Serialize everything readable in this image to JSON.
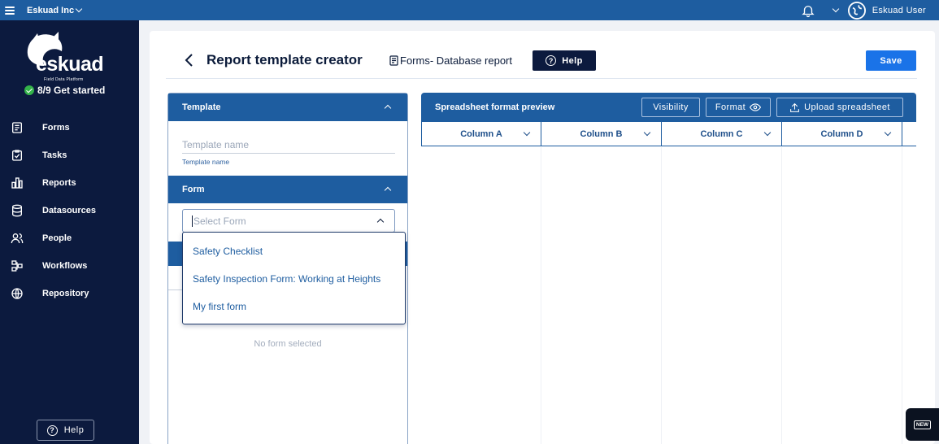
{
  "topbar": {
    "org_name": "Eskuad Inc",
    "user_name": "Eskuad User"
  },
  "sidebar": {
    "logo_text": "eskuad",
    "logo_subtitle": "Field Data Platform",
    "get_started": "8/9 Get started",
    "items": [
      {
        "label": "Forms",
        "icon": "forms-icon"
      },
      {
        "label": "Tasks",
        "icon": "tasks-icon"
      },
      {
        "label": "Reports",
        "icon": "reports-icon"
      },
      {
        "label": "Datasources",
        "icon": "database-icon"
      },
      {
        "label": "People",
        "icon": "people-icon"
      },
      {
        "label": "Workflows",
        "icon": "workflow-icon"
      },
      {
        "label": "Repository",
        "icon": "globe-icon"
      }
    ],
    "help_label": "Help"
  },
  "header": {
    "title": "Report template creator",
    "subtitle": "Forms- Database report",
    "help_label": "Help",
    "save_label": "Save"
  },
  "template_section": {
    "title": "Template",
    "name_placeholder": "Template name",
    "name_helper": "Template name"
  },
  "form_section": {
    "title": "Form",
    "select_placeholder": "Select Form",
    "options": [
      "Safety Checklist",
      "Safety Inspection Form: Working at Heights",
      "My first form"
    ],
    "empty_text": "No form selected"
  },
  "preview": {
    "title": "Spreadsheet format preview",
    "visibility_label": "Visibility",
    "format_label": "Format",
    "upload_label": "Upload spreadsheet",
    "columns": [
      "Column A",
      "Column B",
      "Column C",
      "Column D"
    ]
  },
  "new_badge": "NEW",
  "colors": {
    "primary": "#1e5da0",
    "sidebar": "#0c1a3e",
    "save": "#1a73e8",
    "success": "#34b34a"
  }
}
